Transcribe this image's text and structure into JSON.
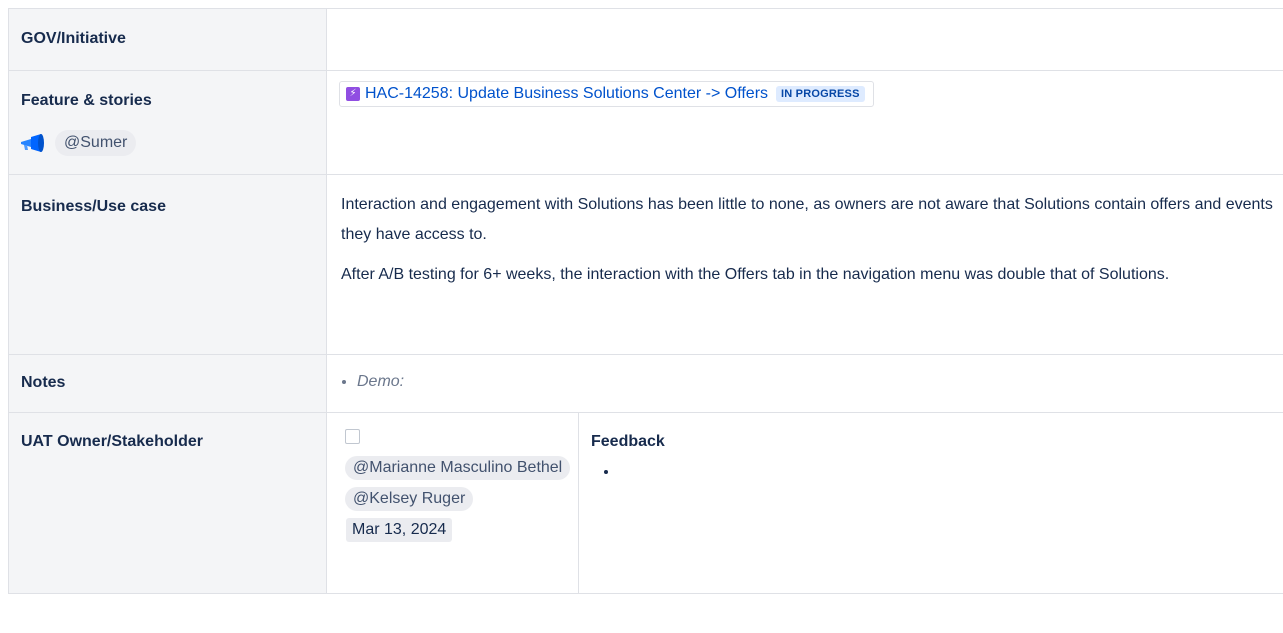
{
  "rows": {
    "gov": {
      "label": "GOV/Initiative"
    },
    "feature": {
      "label": "Feature & stories",
      "owner": "@Sumer",
      "issue": {
        "key_title": "HAC-14258: Update Business Solutions Center -> Offers",
        "status": "IN PROGRESS",
        "icon": "lightning-icon",
        "color": "#904ee2"
      }
    },
    "business": {
      "label": "Business/Use case",
      "para1": "Interaction and engagement with Solutions has been little to none, as owners are not aware that Solutions contain offers and events they have access to.",
      "para2": "After A/B testing for 6+ weeks, the interaction with the Offers tab in the navigation menu was double that of Solutions."
    },
    "notes": {
      "label": "Notes",
      "items": [
        "Demo:"
      ]
    },
    "uat": {
      "label": "UAT Owner/Stakeholder",
      "mention1": "@Marianne Masculino Bethel",
      "mention2": "@Kelsey Ruger",
      "date": "Mar 13, 2024",
      "feedback_title": "Feedback",
      "feedback_items": [
        ""
      ]
    }
  }
}
